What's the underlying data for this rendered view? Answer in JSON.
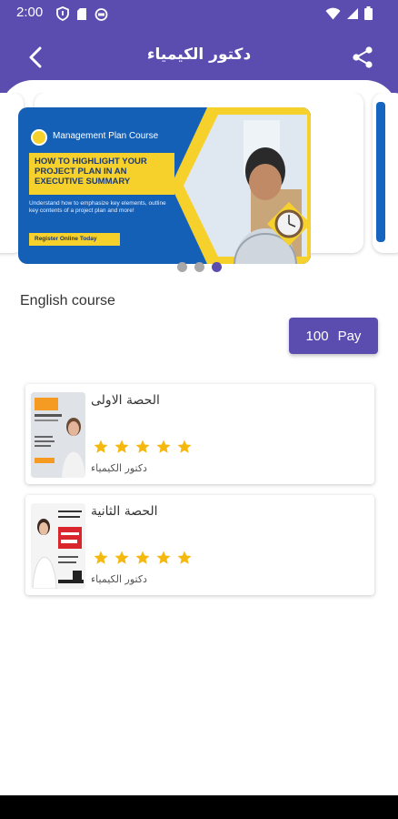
{
  "status_bar": {
    "time": "2:00",
    "left_icons": [
      "shield-icon",
      "sd-card-icon",
      "cat-face-icon"
    ],
    "right_icons": [
      "wifi-icon",
      "signal-icon",
      "battery-icon"
    ]
  },
  "app_bar": {
    "title": "دكتور الكيمياء",
    "back_icon": "chevron-left-icon",
    "share_icon": "share-icon"
  },
  "carousel": {
    "banner": {
      "course_label": "Management Plan Course",
      "headline": "How to highlight your project plan in an executive summary",
      "subtext": "Understand how to emphasize key elements, outline key contents of a project plan and more!",
      "register_label": "Register Online Today"
    },
    "dots": [
      {
        "active": false
      },
      {
        "active": false
      },
      {
        "active": true
      }
    ]
  },
  "course": {
    "name": "English course",
    "price": "100",
    "pay_label": "Pay"
  },
  "lessons": [
    {
      "title": "الحصة الاولى",
      "author": "دكتور الكيمياء",
      "rating": 5
    },
    {
      "title": "الحصة الثانية",
      "author": "دكتور الكيمياء",
      "rating": 5
    }
  ],
  "colors": {
    "primary": "#5b4cb0",
    "star": "#f5b80f",
    "banner_blue": "#1560b7",
    "banner_yellow": "#f6d02b"
  }
}
